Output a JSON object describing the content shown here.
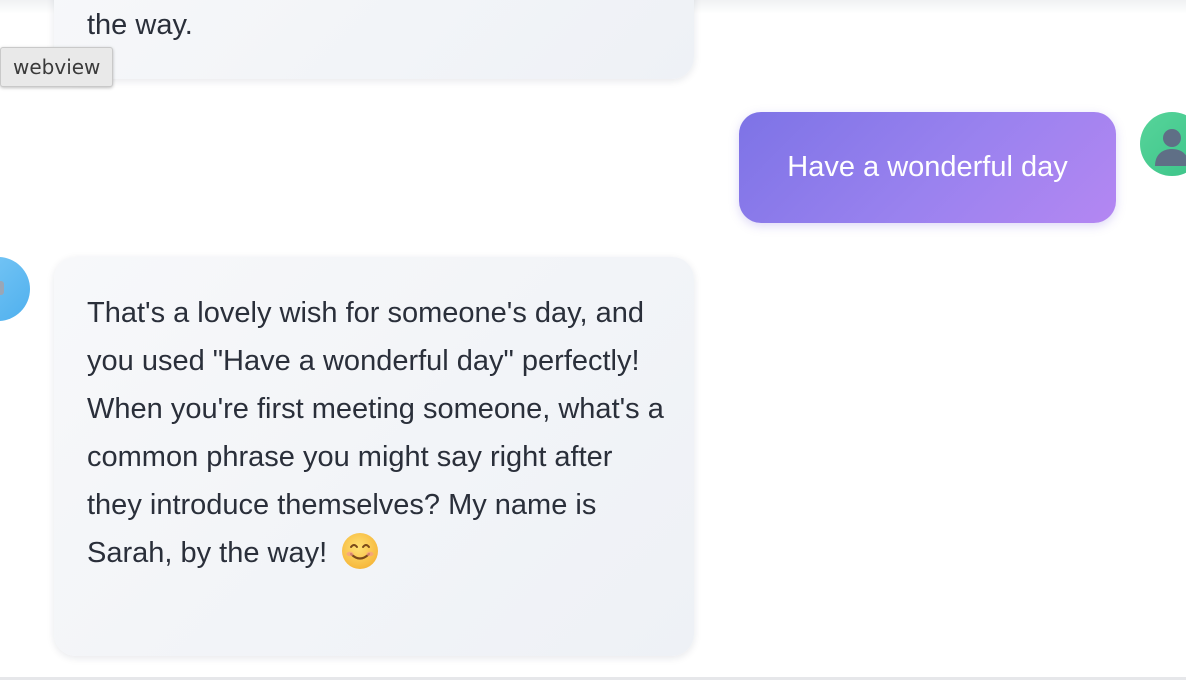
{
  "tooltip": {
    "label": "webview"
  },
  "messages": [
    {
      "role": "assistant",
      "text": "the way."
    },
    {
      "role": "user",
      "text": "Have a wonderful day"
    },
    {
      "role": "assistant",
      "text": "That's a lovely wish for someone's day, and you used \"Have a wonderful day\" perfectly! When you're first meeting someone, what's a common phrase you might say right after they introduce themselves? My name is Sarah, by the way!",
      "emoji": "smiling-face-emoji"
    }
  ],
  "colors": {
    "user_bubble_start": "#7d73e6",
    "user_bubble_end": "#b487f2",
    "assistant_bubble": "#f2f4f8",
    "user_avatar": "#4fcf93",
    "assistant_avatar": "#66bdf2"
  },
  "icons": {
    "user_avatar": "person-icon",
    "assistant_avatar": "robot-icon"
  }
}
